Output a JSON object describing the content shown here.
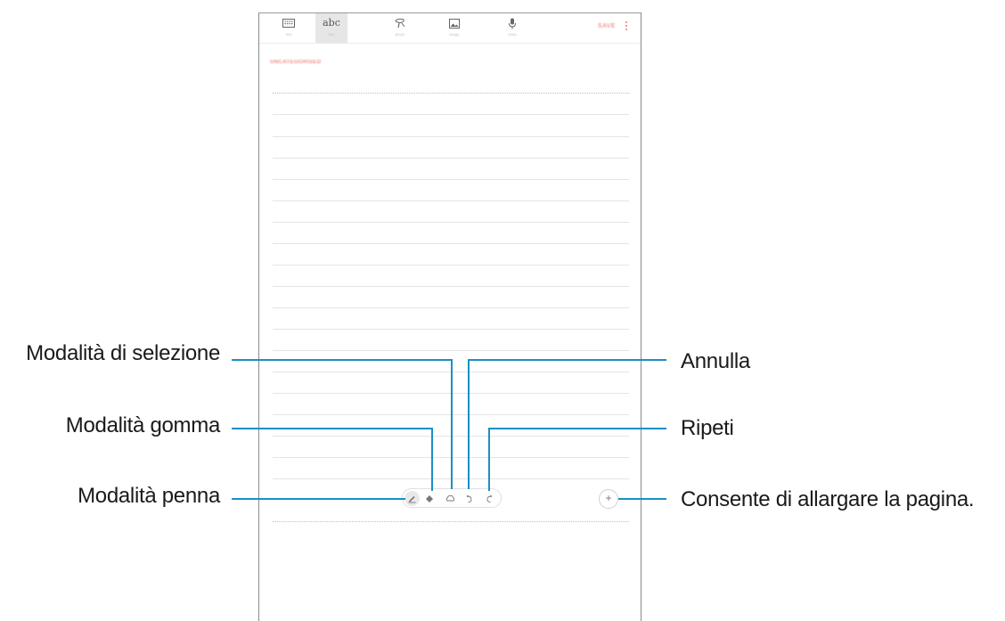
{
  "toolbar": {
    "tabs": [
      {
        "name": "Text",
        "icon": "keyboard-icon",
        "selected": false
      },
      {
        "name": "Pen",
        "icon": "handwriting-icon",
        "glyph": "abc",
        "selected": true
      },
      {
        "name": "Brush",
        "icon": "brush-icon",
        "selected": false
      },
      {
        "name": "Image",
        "icon": "image-icon",
        "selected": false
      },
      {
        "name": "Voice",
        "icon": "microphone-icon",
        "selected": false
      }
    ],
    "save_label": "SAVE",
    "more_icon": "more-vertical-icon"
  },
  "note": {
    "category": "UNCATEGORISED"
  },
  "pen_toolbar": {
    "tools": [
      "pen-icon",
      "eraser-icon",
      "lasso-icon",
      "undo-icon",
      "redo-icon"
    ],
    "expand_label": "+"
  },
  "callouts": {
    "selection_mode": "Modalità di selezione",
    "eraser_mode": "Modalità gomma",
    "pen_mode": "Modalità penna",
    "undo": "Annulla",
    "redo": "Ripeti",
    "expand_page": "Consente di allargare la pagina."
  },
  "colors": {
    "accent": "#e77b73",
    "leader_line": "#1b8fc5",
    "rule": "#e4e4e4"
  }
}
